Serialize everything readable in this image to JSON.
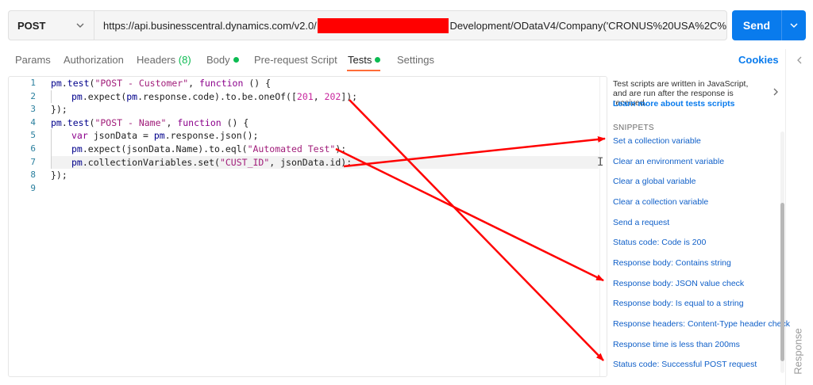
{
  "request": {
    "method": "POST",
    "url_prefix": "https://api.businesscentral.dynamics.com/v2.0/",
    "url_suffix": "Development/ODataV4/Company('CRONUS%20USA%2C%",
    "send_label": "Send"
  },
  "tabs": [
    {
      "label": "Params"
    },
    {
      "label": "Authorization"
    },
    {
      "label": "Headers",
      "count": "(8)"
    },
    {
      "label": "Body"
    },
    {
      "label": "Pre-request Script"
    },
    {
      "label": "Tests"
    },
    {
      "label": "Settings"
    }
  ],
  "cookies_label": "Cookies",
  "editor": {
    "line_numbers": [
      "1",
      "2",
      "3",
      "4",
      "5",
      "6",
      "7",
      "8",
      "9"
    ]
  },
  "panel": {
    "help_text": "Test scripts are written in JavaScript, and are run after the response is received.",
    "learn_more": "Learn more about tests scripts",
    "snippets_heading": "SNIPPETS",
    "snippets": [
      "Set a collection variable",
      "Clear an environment variable",
      "Clear a global variable",
      "Clear a collection variable",
      "Send a request",
      "Status code: Code is 200",
      "Response body: Contains string",
      "Response body: JSON value check",
      "Response body: Is equal to a string",
      "Response headers: Content-Type header check",
      "Response time is less than 200ms",
      "Status code: Successful POST request"
    ]
  },
  "response_label": "Response",
  "colors": {
    "accent": "#097bed",
    "active_tab_underline": "#ff6c37",
    "status_dot": "#0cbb52",
    "redaction": "#ff0000",
    "annotation_arrow": "#ff0000"
  }
}
